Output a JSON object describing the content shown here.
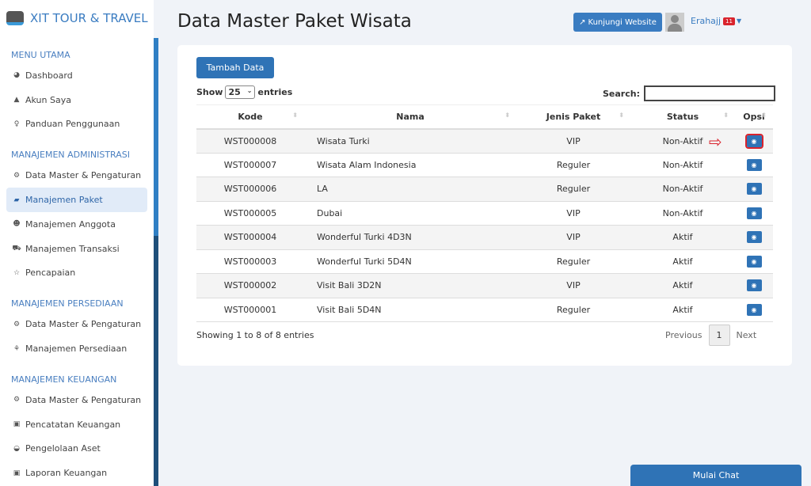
{
  "brand": "XIT TOUR & TRAVEL",
  "sidebar": {
    "s1": "MENU UTAMA",
    "s2": "MANAJEMEN ADMINISTRASI",
    "s3": "MANAJEMEN PERSEDIAAN",
    "s4": "MANAJEMEN KEUANGAN",
    "items": [
      "Dashboard",
      "Akun Saya",
      "Panduan Penggunaan",
      "Data Master & Pengaturan",
      "Manajemen Paket",
      "Manajemen Anggota",
      "Manajemen Transaksi",
      "Pencapaian",
      "Data Master & Pengaturan",
      "Manajemen Persediaan",
      "Data Master & Pengaturan",
      "Pencatatan Keuangan",
      "Pengelolaan Aset",
      "Laporan Keuangan"
    ],
    "active": "Manajemen Paket"
  },
  "header": {
    "title": "Data Master Paket Wisata",
    "visit": "Kunjungi Website",
    "user": "Erahajj",
    "badge": "11"
  },
  "card": {
    "add": "Tambah Data",
    "show": "Show",
    "entries_value": "25",
    "entries": "entries",
    "search": "Search:",
    "columns": [
      "Kode",
      "Nama",
      "Jenis Paket",
      "Status",
      "Opsi"
    ],
    "rows": [
      [
        "WST000008",
        "Wisata Turki",
        "VIP",
        "Non-Aktif"
      ],
      [
        "WST000007",
        "Wisata Alam Indonesia",
        "Reguler",
        "Non-Aktif"
      ],
      [
        "WST000006",
        "LA",
        "Reguler",
        "Non-Aktif"
      ],
      [
        "WST000005",
        "Dubai",
        "VIP",
        "Non-Aktif"
      ],
      [
        "WST000004",
        "Wonderful Turki 4D3N",
        "VIP",
        "Aktif"
      ],
      [
        "WST000003",
        "Wonderful Turki 5D4N",
        "Reguler",
        "Aktif"
      ],
      [
        "WST000002",
        "Visit Bali 3D2N",
        "VIP",
        "Aktif"
      ],
      [
        "WST000001",
        "Visit Bali 5D4N",
        "Reguler",
        "Aktif"
      ]
    ],
    "info": "Showing 1 to 8 of 8 entries",
    "prev": "Previous",
    "page": "1",
    "next": "Next"
  },
  "chat": "Mulai Chat"
}
